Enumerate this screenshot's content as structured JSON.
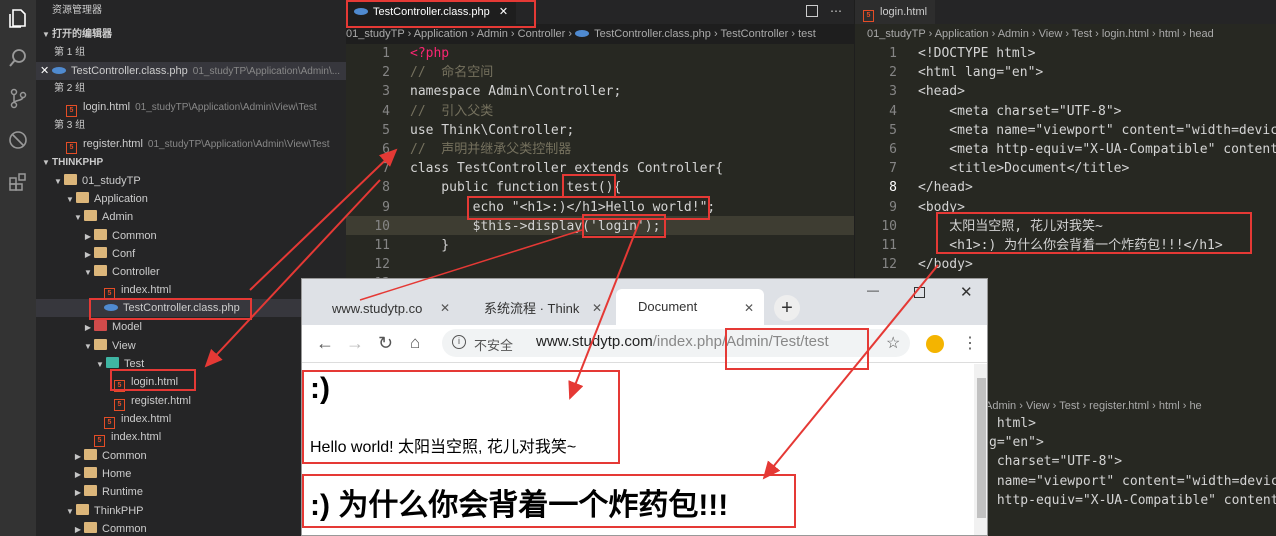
{
  "sidebar": {
    "title": "资源管理器",
    "open_editors": "打开的编辑器",
    "group1": "第 1 组",
    "group1_file": "TestController.class.php",
    "group1_path": "01_studyTP\\Application\\Admin\\...",
    "group2": "第 2 组",
    "group2_file": "login.html",
    "group2_path": "01_studyTP\\Application\\Admin\\View\\Test",
    "group3": "第 3 组",
    "group3_file": "register.html",
    "group3_path": "01_studyTP\\Application\\Admin\\View\\Test",
    "project": "THINKPHP",
    "tree": [
      "01_studyTP",
      "Application",
      "Admin",
      "Common",
      "Conf",
      "Controller",
      "index.html",
      "TestController.class.php",
      "Model",
      "View",
      "Test",
      "login.html",
      "register.html",
      "index.html",
      "index.html",
      "Common",
      "Home",
      "Runtime",
      "ThinkPHP",
      "Common"
    ]
  },
  "editor1": {
    "tab": "TestController.class.php",
    "breadcrumb": [
      "01_studyTP",
      "Application",
      "Admin",
      "Controller",
      "TestController.class.php",
      "TestController",
      "test"
    ],
    "lines": [
      "<?php",
      "//  命名空间",
      "namespace Admin\\Controller;",
      "//  引入父类",
      "use Think\\Controller;",
      "//  声明并继承父类控制器",
      "class TestController extends Controller{",
      "    public function test(){",
      "        echo \"<h1>:)</h1>Hello world!\";",
      "        $this->display('login');",
      "    }",
      "",
      ""
    ]
  },
  "editor2": {
    "tab": "login.html",
    "breadcrumb": [
      "01_studyTP",
      "Application",
      "Admin",
      "View",
      "Test",
      "login.html",
      "html",
      "head"
    ],
    "lines": [
      "<!DOCTYPE html>",
      "<html lang=\"en\">",
      "<head>",
      "    <meta charset=\"UTF-8\">",
      "    <meta name=\"viewport\" content=\"width=devic",
      "    <meta http-equiv=\"X-UA-Compatible\" content",
      "    <title>Document</title>",
      "</head>",
      "<body>",
      "    太阳当空照, 花儿对我笑~",
      "    <h1>:) 为什么你会背着一个炸药包!!!</h1>",
      "</body>"
    ]
  },
  "editor3": {
    "breadcrumb": [
      "Admin",
      "View",
      "Test",
      "register.html",
      "html",
      "he"
    ],
    "lines": [
      " html>",
      "g=\"en\">",
      "",
      " charset=\"UTF-8\">",
      " name=\"viewport\" content=\"width=devic",
      " http-equiv=\"X-UA-Compatible\" content"
    ]
  },
  "browser": {
    "tabs": [
      "www.studytp.co",
      "系统流程 · Think",
      "Document"
    ],
    "security": "不安全",
    "url_host": "www.studytp.com",
    "url_path": "/index.php/Admin/Test/test",
    "h1_small": ":)",
    "text": "Hello world! 太阳当空照, 花儿对我笑~",
    "h1_big": ":) 为什么你会背着一个炸药包!!!"
  },
  "colors": {
    "annotation": "#e53935",
    "editor_bg": "#1e1e1e",
    "sidebar_bg": "#252526"
  }
}
